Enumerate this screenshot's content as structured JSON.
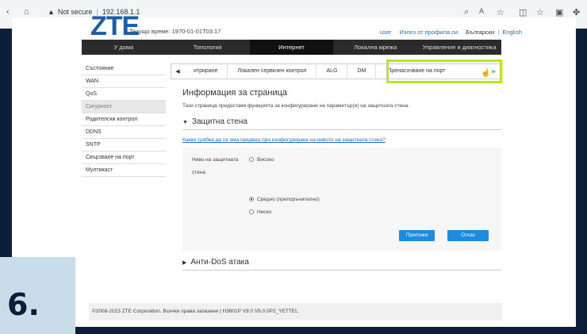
{
  "browser": {
    "security": "Not secure",
    "url": "192.168.1.1"
  },
  "header": {
    "logo": "ZTE",
    "time_label": "Текущо време: 1970-01-01T03:17",
    "user": "user",
    "logout": "Излез от профила си",
    "lang_bg": "Български",
    "lang_en": "English"
  },
  "nav": [
    "У дома",
    "Топология",
    "Интернет",
    "Локална мрежа",
    "Управление и диагностика"
  ],
  "sidebar": [
    "Състояние",
    "WAN",
    "QoS",
    "Сигурност",
    "Родителски контрол",
    "DDNS",
    "SNTP",
    "Свързване на порт",
    "Мултикаст"
  ],
  "tabs": [
    "итриране",
    "Локален сервизен контрол",
    "ALG",
    "DM",
    "Пренасочване на порт"
  ],
  "content": {
    "title": "Информация за страница",
    "description": "Тази страница предоставя функцията за конфигуриране на параметър(и) на защитната стена.",
    "section_firewall": "Защитна стена",
    "help_link": "Какво трябва да се има предвид при конфигуриране на нивото на защитната стена?",
    "level_label_1": "Ниво на защитната",
    "level_label_2": "стена",
    "option_high": "Високо",
    "option_medium": "Средно (препоръчително)",
    "option_low": "Ниско",
    "apply": "Приложи",
    "cancel": "Отказ",
    "section_dos": "Анти-DoS атака"
  },
  "footer": "©2008-2023 ZTE Corporation. Всички права запазени  |   H3601P V9.0 V9.0.0P2_YETTEL",
  "step_badge": "6."
}
